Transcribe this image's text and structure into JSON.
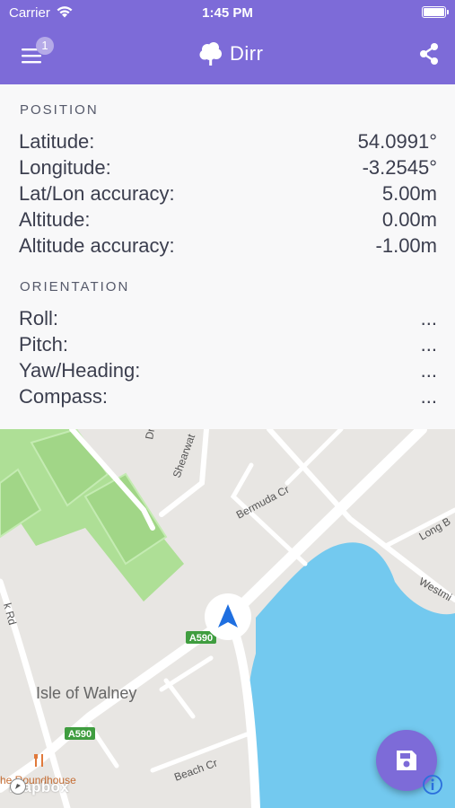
{
  "status_bar": {
    "carrier": "Carrier",
    "time": "1:45 PM"
  },
  "header": {
    "badge_count": "1",
    "title": "Dirr",
    "colors": {
      "primary": "#7d6bd8"
    }
  },
  "position": {
    "title": "POSITION",
    "rows": [
      {
        "label": "Latitude:",
        "value": "54.0991°"
      },
      {
        "label": "Longitude:",
        "value": "-3.2545°"
      },
      {
        "label": "Lat/Lon accuracy:",
        "value": "5.00m"
      },
      {
        "label": "Altitude:",
        "value": "0.00m"
      },
      {
        "label": "Altitude accuracy:",
        "value": "-1.00m"
      }
    ]
  },
  "orientation": {
    "title": "ORIENTATION",
    "rows": [
      {
        "label": "Roll:",
        "value": "..."
      },
      {
        "label": "Pitch:",
        "value": "..."
      },
      {
        "label": "Yaw/Heading:",
        "value": "..."
      },
      {
        "label": "Compass:",
        "value": "..."
      }
    ]
  },
  "map": {
    "labels": {
      "dr": "Dr",
      "shearwater": "Shearwat",
      "bermuda": "Bermuda Cr",
      "long_b": "Long B",
      "westmi": "Westmi",
      "k_rd": "k Rd",
      "a590_top": "A590",
      "a590_bottom": "A590",
      "isle": "Isle of Walney",
      "beach": "Beach Cr",
      "roundhouse": "he Roundhouse"
    },
    "attribution": "mapbox",
    "colors": {
      "water": "#73c9ef",
      "park": "#aedf96",
      "land": "#e8e6e3",
      "road": "#ffffff",
      "shield": "#3f9d3f"
    }
  },
  "icons": {
    "menu": "hamburger-menu-icon",
    "logo": "tree-icon",
    "share": "share-icon",
    "location": "navigation-arrow-icon",
    "save": "floppy-disk-icon",
    "info": "info-icon"
  }
}
